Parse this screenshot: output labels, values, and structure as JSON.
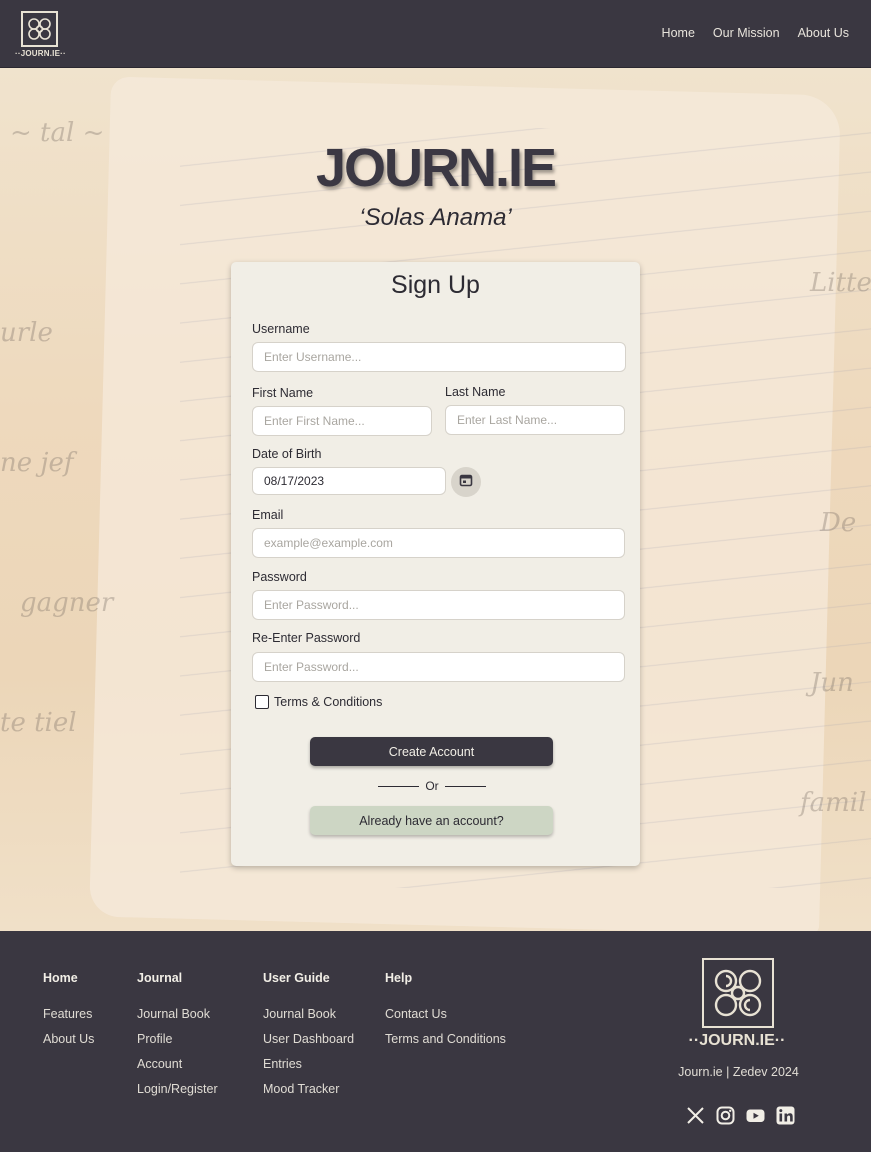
{
  "header": {
    "logo_text": "··JOURN.IE··",
    "nav": [
      {
        "label": "Home"
      },
      {
        "label": "Our Mission"
      },
      {
        "label": "About Us"
      }
    ]
  },
  "hero": {
    "title": "JOURN.IE",
    "motto": "‘Solas Anama’"
  },
  "form": {
    "title": "Sign Up",
    "username": {
      "label": "Username",
      "placeholder": "Enter Username..."
    },
    "first_name": {
      "label": "First Name",
      "placeholder": "Enter First Name..."
    },
    "last_name": {
      "label": "Last Name",
      "placeholder": "Enter Last Name..."
    },
    "dob": {
      "label": "Date of Birth",
      "value": "08/17/2023",
      "icon": "calendar-icon"
    },
    "email": {
      "label": "Email",
      "placeholder": "example@example.com"
    },
    "password": {
      "label": "Password",
      "placeholder": "Enter Password..."
    },
    "reenter_password": {
      "label": "Re-Enter Password",
      "placeholder": "Enter Password..."
    },
    "terms_label": "Terms & Conditions",
    "terms_checked": false,
    "create_button": "Create Account",
    "or_text": "Or",
    "login_button": "Already have an account?"
  },
  "footer": {
    "columns": [
      {
        "heading": "Home",
        "links": [
          "Features",
          "About Us"
        ]
      },
      {
        "heading": "Journal",
        "links": [
          "Journal Book",
          "Profile",
          "Account",
          "Login/Register"
        ]
      },
      {
        "heading": "User Guide",
        "links": [
          "Journal Book",
          "User Dashboard",
          "Entries",
          "Mood Tracker"
        ]
      },
      {
        "heading": "Help",
        "links": [
          "Contact Us",
          "Terms and Conditions"
        ]
      }
    ],
    "logo_text": "··JOURN.IE··",
    "copyright": "Journ.ie | Zedev 2024",
    "socials": [
      "x-icon",
      "instagram-icon",
      "youtube-icon",
      "linkedin-icon"
    ]
  },
  "colors": {
    "header_bg": "#3a3741",
    "card_bg": "#f1eee6",
    "primary_button": "#3a3741",
    "secondary_button": "#cdd6c4"
  }
}
